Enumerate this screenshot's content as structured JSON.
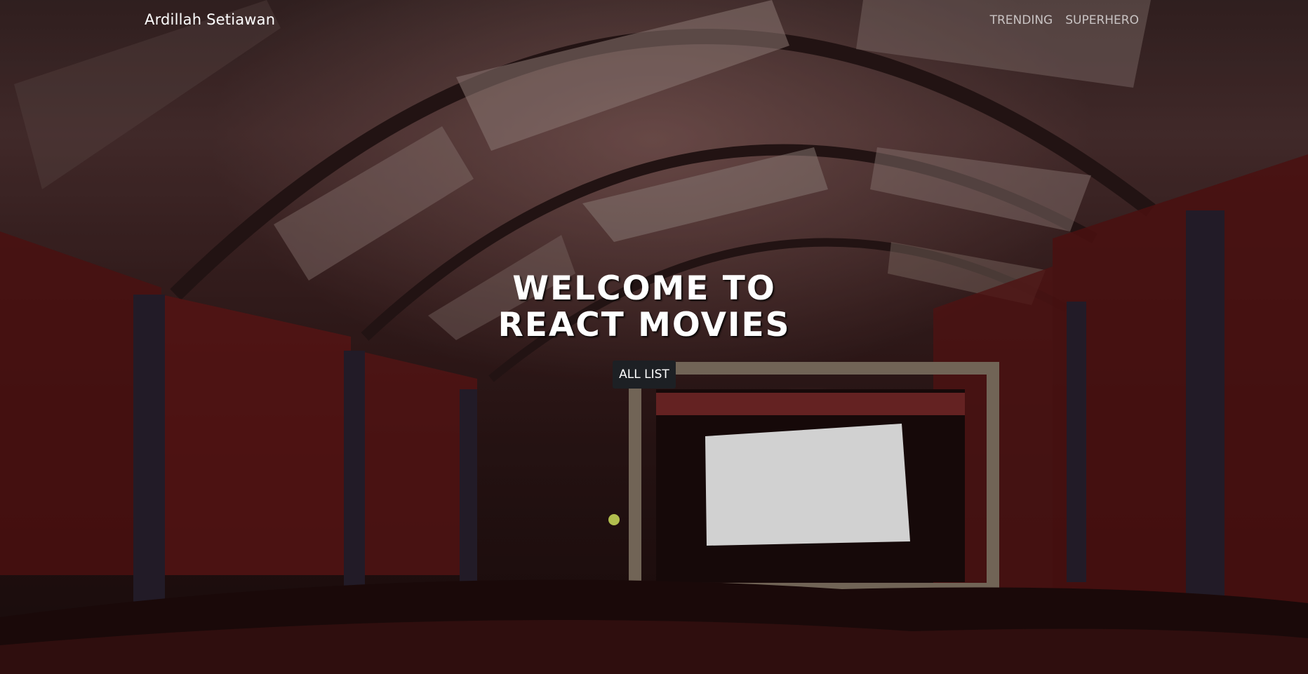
{
  "header": {
    "brand": "Ardillah Setiawan",
    "nav": [
      {
        "label": "TRENDING"
      },
      {
        "label": "SUPERHERO"
      }
    ]
  },
  "hero": {
    "title_line1": "WELCOME TO",
    "title_line2": "REACT MOVIES",
    "button_label": "ALL LIST",
    "background": "cinema-interior-photo"
  },
  "colors": {
    "button_bg": "#1d2024",
    "title": "#ffffff",
    "nav_text": "#c9c3c3"
  }
}
